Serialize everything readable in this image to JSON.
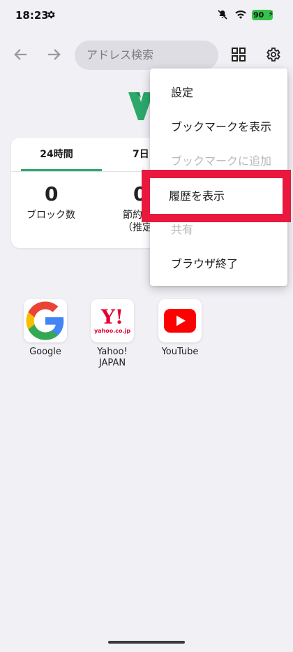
{
  "status_bar": {
    "time": "18:23",
    "battery": "90"
  },
  "toolbar": {
    "address_placeholder": "アドレス検索"
  },
  "stats": {
    "tabs": [
      "24時間",
      "7日"
    ],
    "blocked_value": "0",
    "blocked_label": "ブロック数",
    "saved_value": "0",
    "saved_label": "節約",
    "saved_sub": "（推定"
  },
  "shortcuts": [
    {
      "label": "Google"
    },
    {
      "label": "Yahoo!\nJAPAN",
      "line1": "Yahoo!",
      "line2": "JAPAN",
      "logo_text": "Y!",
      "logo_sub": "yahoo.co.jp"
    },
    {
      "label": "YouTube"
    }
  ],
  "menu": {
    "items": [
      {
        "label": "設定",
        "enabled": true
      },
      {
        "label": "ブックマークを表示",
        "enabled": true
      },
      {
        "label": "ブックマークに追加",
        "enabled": false
      },
      {
        "label": "履歴を表示",
        "enabled": true
      },
      {
        "label": "共有",
        "enabled": false
      },
      {
        "label": "ブラウザ終了",
        "enabled": true
      }
    ]
  },
  "colors": {
    "accent_green": "#2ca86b",
    "highlight_red": "#e8193d",
    "youtube_red": "#ff0000",
    "yahoo_red": "#e60033"
  }
}
